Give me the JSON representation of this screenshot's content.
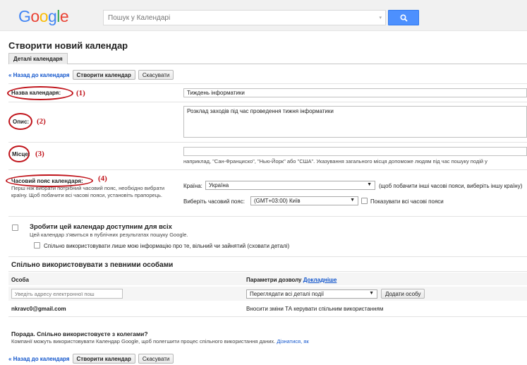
{
  "header": {
    "logo": [
      "G",
      "o",
      "o",
      "g",
      "l",
      "e"
    ],
    "logo_colors": [
      "#4285f4",
      "#ea4335",
      "#fbbc05",
      "#4285f4",
      "#34a853",
      "#ea4335"
    ],
    "search_placeholder": "Пошук у Календарі",
    "search_button_icon": "search-icon",
    "accent": "#4d90fe"
  },
  "page": {
    "title": "Створити новий календар",
    "tab": "Деталі календаря"
  },
  "toolbar": {
    "back_label": "« Назад до календаря",
    "create_label": "Створити календар",
    "cancel_label": "Скасувати"
  },
  "form": {
    "name_label": "Назва календаря:",
    "name_num": "(1)",
    "name_value": "Тиждень інформатики",
    "desc_label": "Опис:",
    "desc_num": "(2)",
    "desc_value": "Розклад заходів під час проведення тижня інформатики",
    "place_label": "Місце:",
    "place_num": "(3)",
    "place_value": "",
    "place_help": "наприклад, \"Сан-Франциско\", \"Нью-Йорк\" або \"США\". Указування загального місця допоможе людям під час пошуку подій у",
    "tz_label": "Часовий пояс календаря:",
    "tz_num": "(4)",
    "tz_help": "Перш ніж вибрати потрібний часовий пояс, необхідно вибрати країну. Щоб побачити всі часові пояси, установіть прапорець.",
    "country_label": "Країна:",
    "country_value": "Україна",
    "country_hint": "(щоб побачити інші часові пояси, виберіть іншу країну)",
    "tz_select_label": "Виберіть часовий пояс:",
    "tz_value": "(GMT+03:00) Київ",
    "show_all_tz": "Показувати всі часові пояси",
    "highlight_color": "#c0131a"
  },
  "public": {
    "title": "Зробити цей календар доступним для всіх",
    "help": "Цей календар з'явиться в публічних результатах пошуку Google.",
    "free_busy": "Спільно використовувати лише мою інформацію про те, вільний чи зайнятий (сховати деталі)"
  },
  "sharing": {
    "title": "Спільно використовувати з певними особами",
    "col_person": "Особа",
    "col_perms": "Параметри дозволу",
    "more_link": "Докладніше",
    "email_placeholder": "Уведіть адресу електронної пош",
    "perm_value": "Переглядати всі деталі події",
    "add_button": "Додати особу",
    "rows": [
      {
        "person": "nkravc0@gmail.com",
        "permission": "Вносити зміни ТА керувати спільним використанням"
      }
    ]
  },
  "tip": {
    "title": "Порада. Спільно використовуєте з колегами?",
    "text": "Компанії можуть використовувати Календар Google, щоб полегшити процес спільного використання даних.",
    "link": "Дізнатися, як"
  }
}
